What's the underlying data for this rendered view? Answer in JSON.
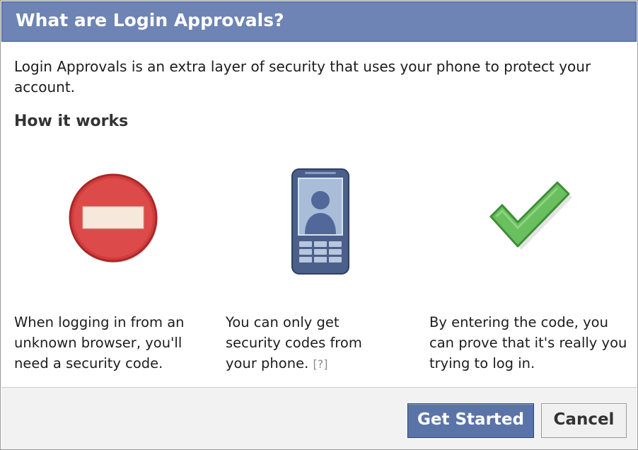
{
  "dialog": {
    "title": "What are Login Approvals?",
    "intro": "Login Approvals is an extra layer of security that uses your phone to protect your account.",
    "section_heading": "How it works"
  },
  "steps": [
    {
      "icon": "no-entry-icon",
      "text": "When logging in from an unknown browser, you'll need a security code."
    },
    {
      "icon": "phone-icon",
      "text": "You can only get security codes from your phone.",
      "help_link": "[?]"
    },
    {
      "icon": "checkmark-icon",
      "text": "By entering the code, you can prove that it's really you trying to log in."
    }
  ],
  "footer": {
    "primary_label": "Get Started",
    "secondary_label": "Cancel"
  },
  "colors": {
    "titlebar": "#6d84b4",
    "primary_button": "#5b74a8",
    "no_entry_red": "#cc3333",
    "check_green": "#6abf5e",
    "phone_blue": "#4a5f8a"
  }
}
